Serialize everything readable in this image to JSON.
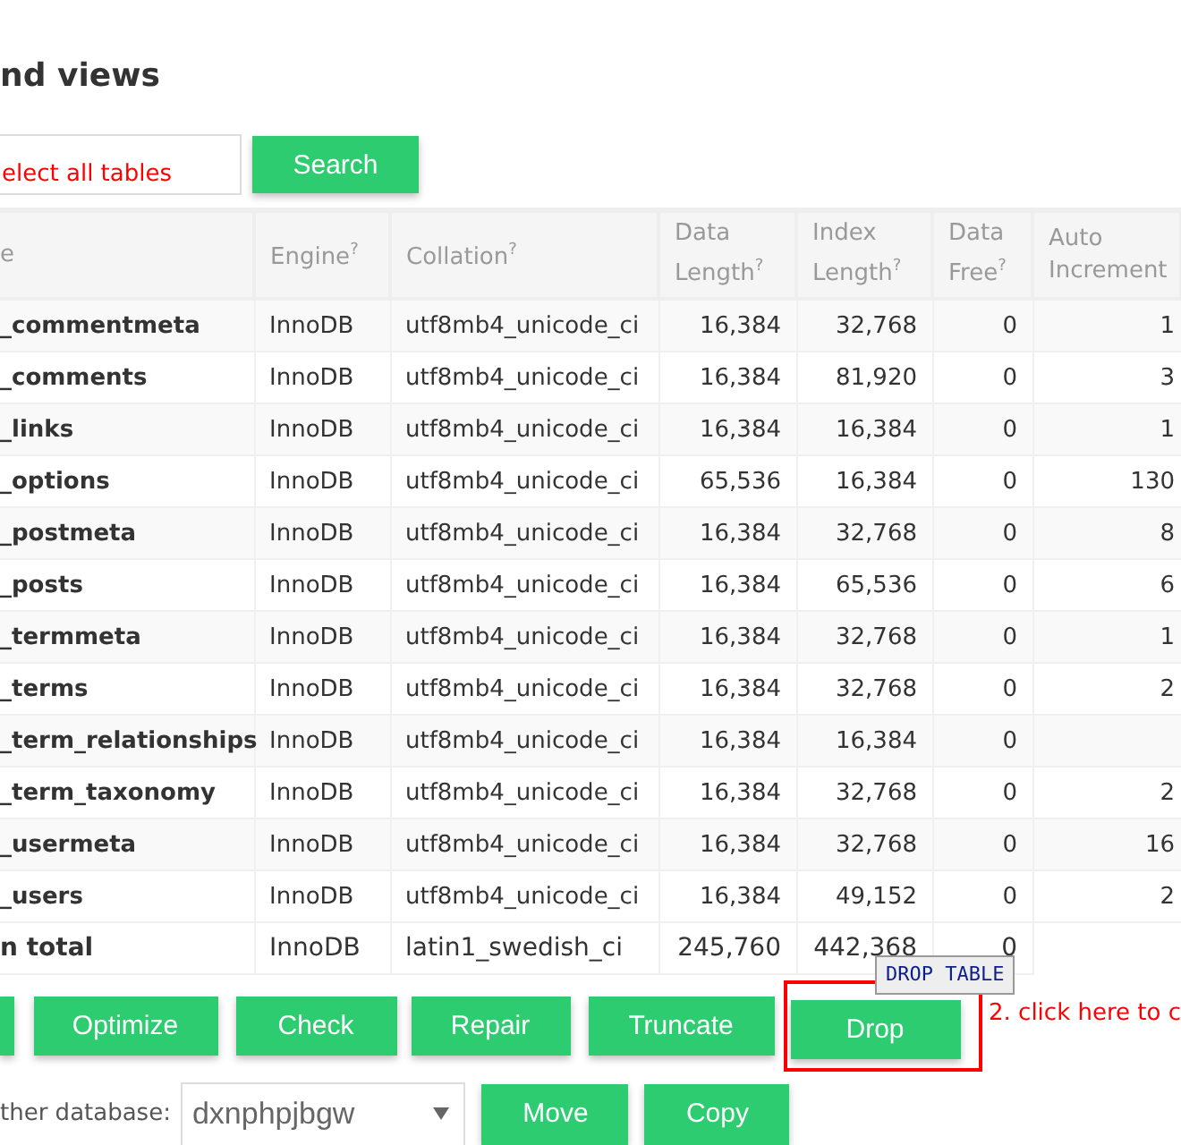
{
  "heading": "nd views",
  "search": {
    "value": "elect all tables",
    "button": "Search"
  },
  "table": {
    "columns": [
      "e",
      "Engine$^{?}$",
      "Collation$^{?}$",
      "Data Length$^{?}$",
      "Index Length$^{?}$",
      "Data Free$^{?}$",
      "Auto Increment"
    ],
    "rows": [
      [
        "_commentmeta",
        "InnoDB",
        "utf8mb4_unicode_ci",
        "16,384",
        "32,768",
        "0",
        "1"
      ],
      [
        "_comments",
        "InnoDB",
        "utf8mb4_unicode_ci",
        "16,384",
        "81,920",
        "0",
        "3"
      ],
      [
        "_links",
        "InnoDB",
        "utf8mb4_unicode_ci",
        "16,384",
        "16,384",
        "0",
        "1"
      ],
      [
        "_options",
        "InnoDB",
        "utf8mb4_unicode_ci",
        "65,536",
        "16,384",
        "0",
        "130"
      ],
      [
        "_postmeta",
        "InnoDB",
        "utf8mb4_unicode_ci",
        "16,384",
        "32,768",
        "0",
        "8"
      ],
      [
        "_posts",
        "InnoDB",
        "utf8mb4_unicode_ci",
        "16,384",
        "65,536",
        "0",
        "6"
      ],
      [
        "_termmeta",
        "InnoDB",
        "utf8mb4_unicode_ci",
        "16,384",
        "32,768",
        "0",
        "1"
      ],
      [
        "_terms",
        "InnoDB",
        "utf8mb4_unicode_ci",
        "16,384",
        "32,768",
        "0",
        "2"
      ],
      [
        "_term_relationships",
        "InnoDB",
        "utf8mb4_unicode_ci",
        "16,384",
        "16,384",
        "0",
        null
      ],
      [
        "_term_taxonomy",
        "InnoDB",
        "utf8mb4_unicode_ci",
        "16,384",
        "32,768",
        "0",
        "2"
      ],
      [
        "_usermeta",
        "InnoDB",
        "utf8mb4_unicode_ci",
        "16,384",
        "32,768",
        "0",
        "16"
      ],
      [
        "_users",
        "InnoDB",
        "utf8mb4_unicode_ci",
        "16,384",
        "49,152",
        "0",
        "2"
      ]
    ],
    "total": [
      "n total",
      "InnoDB",
      "latin1_swedish_ci",
      "245,760",
      "442,368",
      "0"
    ]
  },
  "actions": {
    "partial_button": true,
    "buttons": [
      {
        "label": "Optimize",
        "highlighted": false
      },
      {
        "label": "Check",
        "highlighted": false
      },
      {
        "label": "Repair",
        "highlighted": false
      },
      {
        "label": "Truncate",
        "highlighted": false
      },
      {
        "label": "Drop",
        "highlighted": true
      }
    ],
    "tooltip": "DROP TABLE",
    "annotation": "2. click here to c"
  },
  "move": {
    "label": "ther database:",
    "database": "dxnphpjbgw",
    "buttons": [
      "Move",
      "Copy"
    ]
  }
}
